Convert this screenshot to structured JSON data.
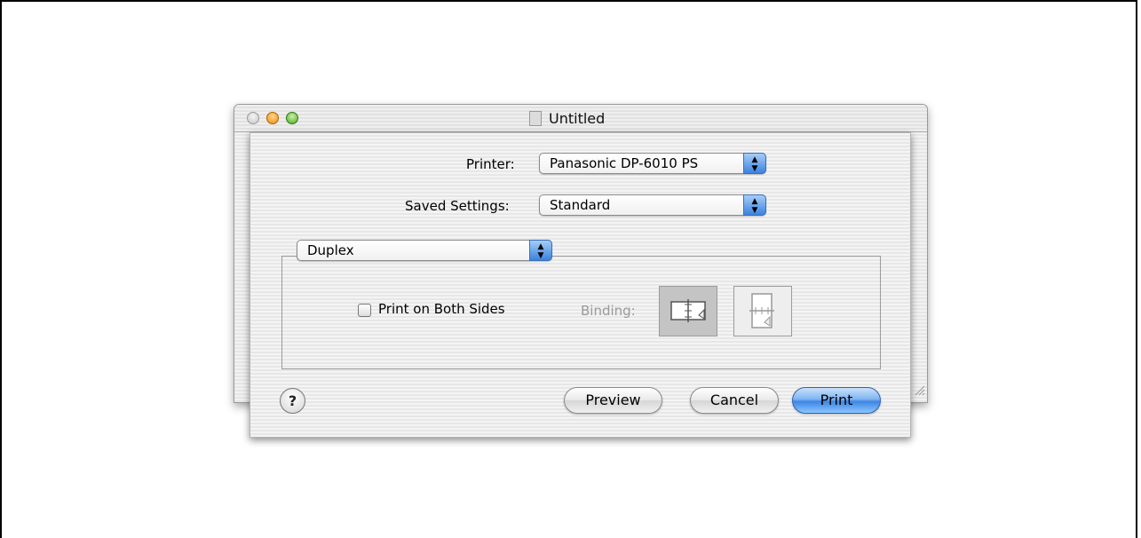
{
  "window": {
    "title": "Untitled"
  },
  "print_dialog": {
    "printer_label": "Printer:",
    "printer_value": "Panasonic DP-6010 PS",
    "saved_settings_label": "Saved Settings:",
    "saved_settings_value": "Standard",
    "panel_value": "Duplex",
    "duplex": {
      "checkbox_label": "Print on Both Sides",
      "checked": false,
      "binding_label": "Binding:",
      "binding_options": [
        "long-edge-binding-icon",
        "short-edge-binding-icon"
      ]
    },
    "help_label": "?",
    "preview_label": "Preview",
    "cancel_label": "Cancel",
    "print_label": "Print"
  },
  "colors": {
    "default_button": "#3d86e4",
    "popup_arrow": "#3b82e0",
    "disabled_text": "#9a9a9a"
  }
}
